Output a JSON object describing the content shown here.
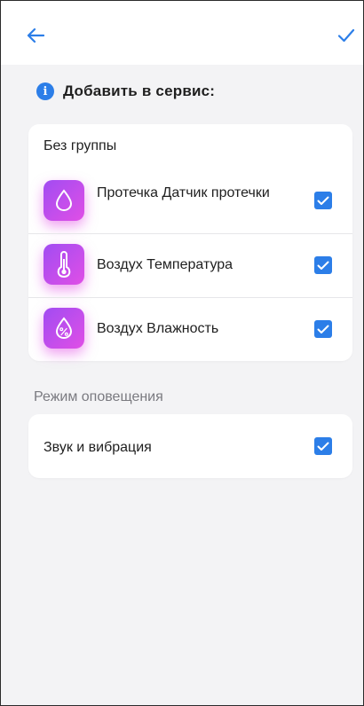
{
  "header": {
    "back_icon": "arrow-left-icon",
    "done_icon": "checkmark-icon",
    "accent_color": "#2c7ee8"
  },
  "info": {
    "icon": "info-icon",
    "title": "Добавить в сервис:"
  },
  "group": {
    "title": "Без группы",
    "devices": [
      {
        "label": "Протечка Датчик протечки",
        "icon": "water-drop-icon",
        "checked": true
      },
      {
        "label": "Воздух Температура",
        "icon": "thermometer-icon",
        "checked": true
      },
      {
        "label": "Воздух Влажность",
        "icon": "humidity-drop-icon",
        "checked": true
      }
    ]
  },
  "notification": {
    "section_title": "Режим оповещения",
    "option_label": "Звук и вибрация",
    "checked": true
  }
}
